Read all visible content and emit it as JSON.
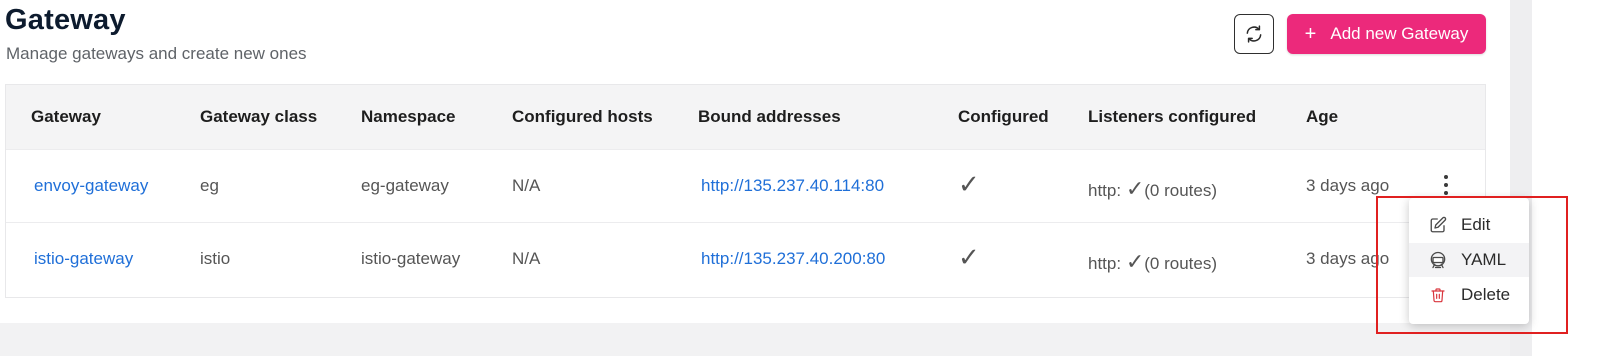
{
  "header": {
    "title": "Gateway",
    "subtitle": "Manage gateways and create new ones",
    "add_button_label": "Add new Gateway",
    "add_button_plus": "+"
  },
  "table": {
    "columns": [
      "Gateway",
      "Gateway class",
      "Namespace",
      "Configured hosts",
      "Bound addresses",
      "Configured",
      "Listeners configured",
      "Age"
    ],
    "rows": [
      {
        "gateway": "envoy-gateway",
        "gateway_class": "eg",
        "namespace": "eg-gateway",
        "configured_hosts": "N/A",
        "bound_address": "http://135.237.40.114:80",
        "configured": "✓",
        "listeners_prefix": "http: ",
        "listeners_check": "✓",
        "listeners_suffix": "(0 routes)",
        "age": "3 days ago"
      },
      {
        "gateway": "istio-gateway",
        "gateway_class": "istio",
        "namespace": "istio-gateway",
        "configured_hosts": "N/A",
        "bound_address": "http://135.237.40.200:80",
        "configured": "✓",
        "listeners_prefix": "http: ",
        "listeners_check": "✓",
        "listeners_suffix": "(0 routes)",
        "age": "3 days ago"
      }
    ]
  },
  "context_menu": {
    "items": [
      {
        "label": "Edit",
        "icon": "edit-icon"
      },
      {
        "label": "YAML",
        "icon": "yaml-icon"
      },
      {
        "label": "Delete",
        "icon": "trash-icon"
      }
    ]
  },
  "colors": {
    "accent": "#ec297b",
    "link": "#1f6fd8",
    "highlight": "#e02020",
    "delete_icon": "#d9363e"
  }
}
